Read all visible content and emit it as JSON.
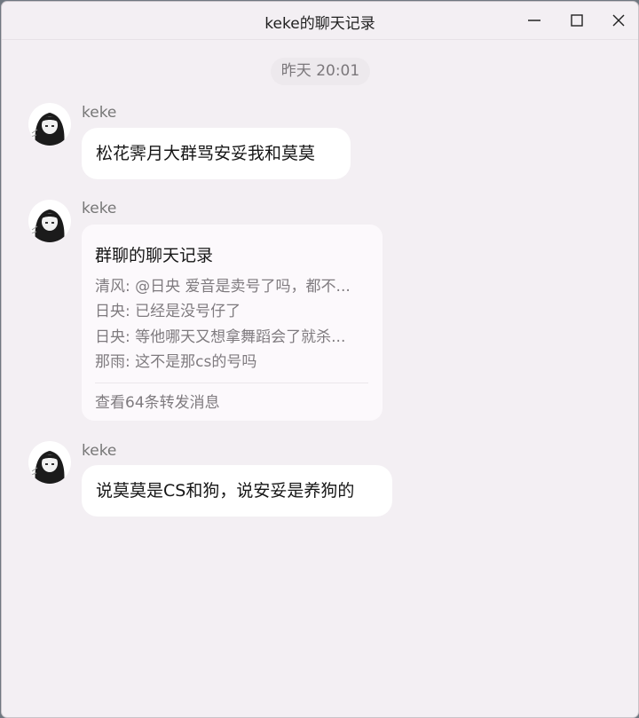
{
  "window": {
    "title": "keke的聊天记录",
    "controls": {
      "minimize": "minimize",
      "maximize": "maximize",
      "close": "close"
    }
  },
  "timestamp": "昨天 20:01",
  "messages": [
    {
      "sender": "keke",
      "text": "松花霁月大群骂安妥我和莫莫"
    },
    {
      "sender": "keke",
      "forward": {
        "title": "群聊的聊天记录",
        "lines": [
          "清风: @日央 爱音是卖号了吗，都不...",
          "日央: 已经是没号仔了",
          "日央: 等他哪天又想拿舞蹈会了就杀...",
          "那雨: 这不是那cs的号吗"
        ],
        "footer": "查看64条转发消息"
      }
    },
    {
      "sender": "keke",
      "text": "说莫莫是CS和狗，说安妥是养狗的"
    }
  ],
  "colors": {
    "window_bg": "#f3eff3",
    "bubble_bg": "#ffffff",
    "card_bg": "#fcf9fc",
    "secondary_text": "#7f7b7f"
  },
  "icons": {
    "avatar": "anime-avatar"
  }
}
